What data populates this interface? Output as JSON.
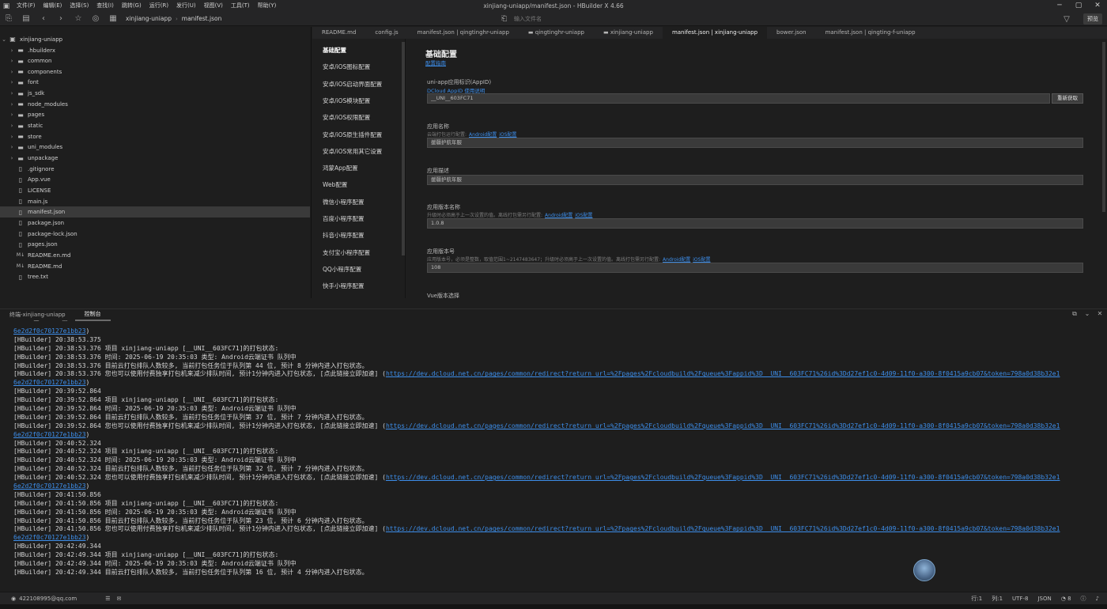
{
  "window": {
    "title": "xinjiang-uniapp/manifest.json - HBuilder X 4.66",
    "menu": [
      "文件(F)",
      "编辑(E)",
      "选择(S)",
      "查找(I)",
      "跳转(G)",
      "运行(R)",
      "发行(U)",
      "视图(V)",
      "工具(T)",
      "帮助(Y)"
    ]
  },
  "toolbar": {
    "breadcrumb": [
      "xinjiang-uniapp",
      "manifest.json"
    ],
    "file_search_placeholder": "输入文件名",
    "preview_label": "预览"
  },
  "explorer": {
    "root": "xinjiang-uniapp",
    "items": [
      {
        "name": ".hbuilderx",
        "type": "folder"
      },
      {
        "name": "common",
        "type": "folder"
      },
      {
        "name": "components",
        "type": "folder"
      },
      {
        "name": "font",
        "type": "folder"
      },
      {
        "name": "js_sdk",
        "type": "folder"
      },
      {
        "name": "node_modules",
        "type": "folder"
      },
      {
        "name": "pages",
        "type": "folder"
      },
      {
        "name": "static",
        "type": "folder"
      },
      {
        "name": "store",
        "type": "folder"
      },
      {
        "name": "uni_modules",
        "type": "folder"
      },
      {
        "name": "unpackage",
        "type": "folder"
      },
      {
        "name": ".gitignore",
        "type": "file"
      },
      {
        "name": "App.vue",
        "type": "file"
      },
      {
        "name": "LICENSE",
        "type": "file"
      },
      {
        "name": "main.js",
        "type": "file"
      },
      {
        "name": "manifest.json",
        "type": "file",
        "selected": true
      },
      {
        "name": "package.json",
        "type": "file"
      },
      {
        "name": "package-lock.json",
        "type": "file"
      },
      {
        "name": "pages.json",
        "type": "file"
      },
      {
        "name": "README.en.md",
        "type": "md"
      },
      {
        "name": "README.md",
        "type": "md"
      },
      {
        "name": "tree.txt",
        "type": "file"
      }
    ]
  },
  "tabs": [
    {
      "label": "README.md"
    },
    {
      "label": "config.js"
    },
    {
      "label": "manifest.json | qingtinghr-uniapp"
    },
    {
      "label": "qingtinghr-uniapp",
      "folder": true
    },
    {
      "label": "xinjiang-uniapp",
      "folder": true
    },
    {
      "label": "manifest.json | xinjiang-uniapp",
      "active": true
    },
    {
      "label": "bower.json"
    },
    {
      "label": "manifest.json | qingting-f-uniapp"
    }
  ],
  "config_nav": [
    "基础配置",
    "安卓/iOS图标配置",
    "安卓/iOS启动界面配置",
    "安卓/iOS模块配置",
    "安卓/iOS权限配置",
    "安卓/iOS原生插件配置",
    "安卓/iOS常用其它设置",
    "鸿蒙App配置",
    "Web配置",
    "微信小程序配置",
    "百度小程序配置",
    "抖音小程序配置",
    "支付宝小程序配置",
    "QQ小程序配置",
    "快手小程序配置"
  ],
  "form": {
    "title": "基础配置",
    "guide_link": "配置指南",
    "appid": {
      "label": "uni-app应用标识(AppID)",
      "hint_link": "DCloud AppID 使用说明",
      "value": "__UNI__603FC71",
      "button": "重新获取"
    },
    "app_name": {
      "label": "应用名称",
      "hint": "云端打包运行配置:",
      "links": [
        "Android配置",
        "iOS配置"
      ],
      "value": "援疆护航年服"
    },
    "app_desc": {
      "label": "应用描述",
      "value": "援疆护航年服"
    },
    "version_name": {
      "label": "应用版本名称",
      "hint": "升级时必须高于上一次设置的值。离线打包需另行配置:",
      "links": [
        "Android配置",
        "iOS配置"
      ],
      "value": "1.0.8"
    },
    "version_code": {
      "label": "应用版本号",
      "hint": "应用版本号，必须是整数，取值范围1~2147483647；升级时必须高于上一次设置的值。离线打包需另行配置:",
      "links": [
        "Android配置",
        "iOS配置"
      ],
      "value": "108"
    },
    "vue_version": {
      "label": "Vue版本选择"
    }
  },
  "panel": {
    "tabs": [
      "终端-xinjiang-uniapp",
      "控制台"
    ],
    "active_tab": 1
  },
  "console": {
    "lines": [
      {
        "text": "",
        "link": "6e2d2f0c70127e1bb23",
        "suffix": ")"
      },
      {
        "text": "[HBuilder] 20:38:53.375"
      },
      {
        "text": "[HBuilder] 20:38:53.376 项目 xinjiang-uniapp [__UNI__603FC71]的打包状态:"
      },
      {
        "text": "[HBuilder] 20:38:53.376 时间: 2025-06-19 20:35:03    类型: Android云端证书    队列中"
      },
      {
        "text": "[HBuilder] 20:38:53.376 目前云打包排队人数较多, 当前打包任务位于队列第 44 位, 预计 8 分钟内进入打包状态。"
      },
      {
        "text": "[HBuilder] 20:38:53.376 您也可以使用付费独享打包机来减少排队时间, 预计1分钟内进入打包状态, [点此链接立即加速] (",
        "link": "https://dev.dcloud.net.cn/pages/common/redirect?return_url=%2Fpages%2Fcloudbuild%2Fqueue%3Fappid%3D__UNI__603FC71%26id%3Dd27ef1c0-4d09-11f0-a300-8f0415a9cb07&token=798a0d38b32e1"
      },
      {
        "text": "",
        "link": "6e2d2f0c70127e1bb23",
        "suffix": ")"
      },
      {
        "text": "[HBuilder] 20:39:52.864"
      },
      {
        "text": "[HBuilder] 20:39:52.864 项目 xinjiang-uniapp [__UNI__603FC71]的打包状态:"
      },
      {
        "text": "[HBuilder] 20:39:52.864 时间: 2025-06-19 20:35:03    类型: Android云端证书    队列中"
      },
      {
        "text": "[HBuilder] 20:39:52.864 目前云打包排队人数较多, 当前打包任务位于队列第 37 位, 预计 7 分钟内进入打包状态。"
      },
      {
        "text": "[HBuilder] 20:39:52.864 您也可以使用付费独享打包机来减少排队时间, 预计1分钟内进入打包状态, [点此链接立即加速] (",
        "link": "https://dev.dcloud.net.cn/pages/common/redirect?return_url=%2Fpages%2Fcloudbuild%2Fqueue%3Fappid%3D__UNI__603FC71%26id%3Dd27ef1c0-4d09-11f0-a300-8f0415a9cb07&token=798a0d38b32e1"
      },
      {
        "text": "",
        "link": "6e2d2f0c70127e1bb23",
        "suffix": ")"
      },
      {
        "text": "[HBuilder] 20:40:52.324"
      },
      {
        "text": "[HBuilder] 20:40:52.324 项目 xinjiang-uniapp [__UNI__603FC71]的打包状态:"
      },
      {
        "text": "[HBuilder] 20:40:52.324 时间: 2025-06-19 20:35:03    类型: Android云端证书    队列中"
      },
      {
        "text": "[HBuilder] 20:40:52.324 目前云打包排队人数较多, 当前打包任务位于队列第 32 位, 预计 7 分钟内进入打包状态。"
      },
      {
        "text": "[HBuilder] 20:40:52.324 您也可以使用付费独享打包机来减少排队时间, 预计1分钟内进入打包状态, [点此链接立即加速] (",
        "link": "https://dev.dcloud.net.cn/pages/common/redirect?return_url=%2Fpages%2Fcloudbuild%2Fqueue%3Fappid%3D__UNI__603FC71%26id%3Dd27ef1c0-4d09-11f0-a300-8f0415a9cb07&token=798a0d38b32e1"
      },
      {
        "text": "",
        "link": "6e2d2f0c70127e1bb23",
        "suffix": ")"
      },
      {
        "text": "[HBuilder] 20:41:50.856"
      },
      {
        "text": "[HBuilder] 20:41:50.856 项目 xinjiang-uniapp [__UNI__603FC71]的打包状态:"
      },
      {
        "text": "[HBuilder] 20:41:50.856 时间: 2025-06-19 20:35:03    类型: Android云端证书    队列中"
      },
      {
        "text": "[HBuilder] 20:41:50.856 目前云打包排队人数较多, 当前打包任务位于队列第 23 位, 预计 6 分钟内进入打包状态。"
      },
      {
        "text": "[HBuilder] 20:41:50.856 您也可以使用付费独享打包机来减少排队时间, 预计1分钟内进入打包状态, [点此链接立即加速] (",
        "link": "https://dev.dcloud.net.cn/pages/common/redirect?return_url=%2Fpages%2Fcloudbuild%2Fqueue%3Fappid%3D__UNI__603FC71%26id%3Dd27ef1c0-4d09-11f0-a300-8f0415a9cb07&token=798a0d38b32e1"
      },
      {
        "text": "",
        "link": "6e2d2f0c70127e1bb23",
        "suffix": ")"
      },
      {
        "text": "[HBuilder] 20:42:49.344"
      },
      {
        "text": "[HBuilder] 20:42:49.344 项目 xinjiang-uniapp [__UNI__603FC71]的打包状态:"
      },
      {
        "text": "[HBuilder] 20:42:49.344 时间: 2025-06-19 20:35:03    类型: Android云端证书    队列中"
      },
      {
        "text": "[HBuilder] 20:42:49.344 目前云打包排队人数较多, 当前打包任务位于队列第 16 位, 预计 4 分钟内进入打包状态。"
      }
    ]
  },
  "statusbar": {
    "user": "422108995@qq.com",
    "line": "行:1",
    "column": "列:1",
    "encoding": "UTF-8",
    "language": "JSON",
    "notifications": "8"
  },
  "colors": {
    "background": "#1e1e1e",
    "link": "#3d8eea",
    "selected_row": "#3a3a3a"
  }
}
